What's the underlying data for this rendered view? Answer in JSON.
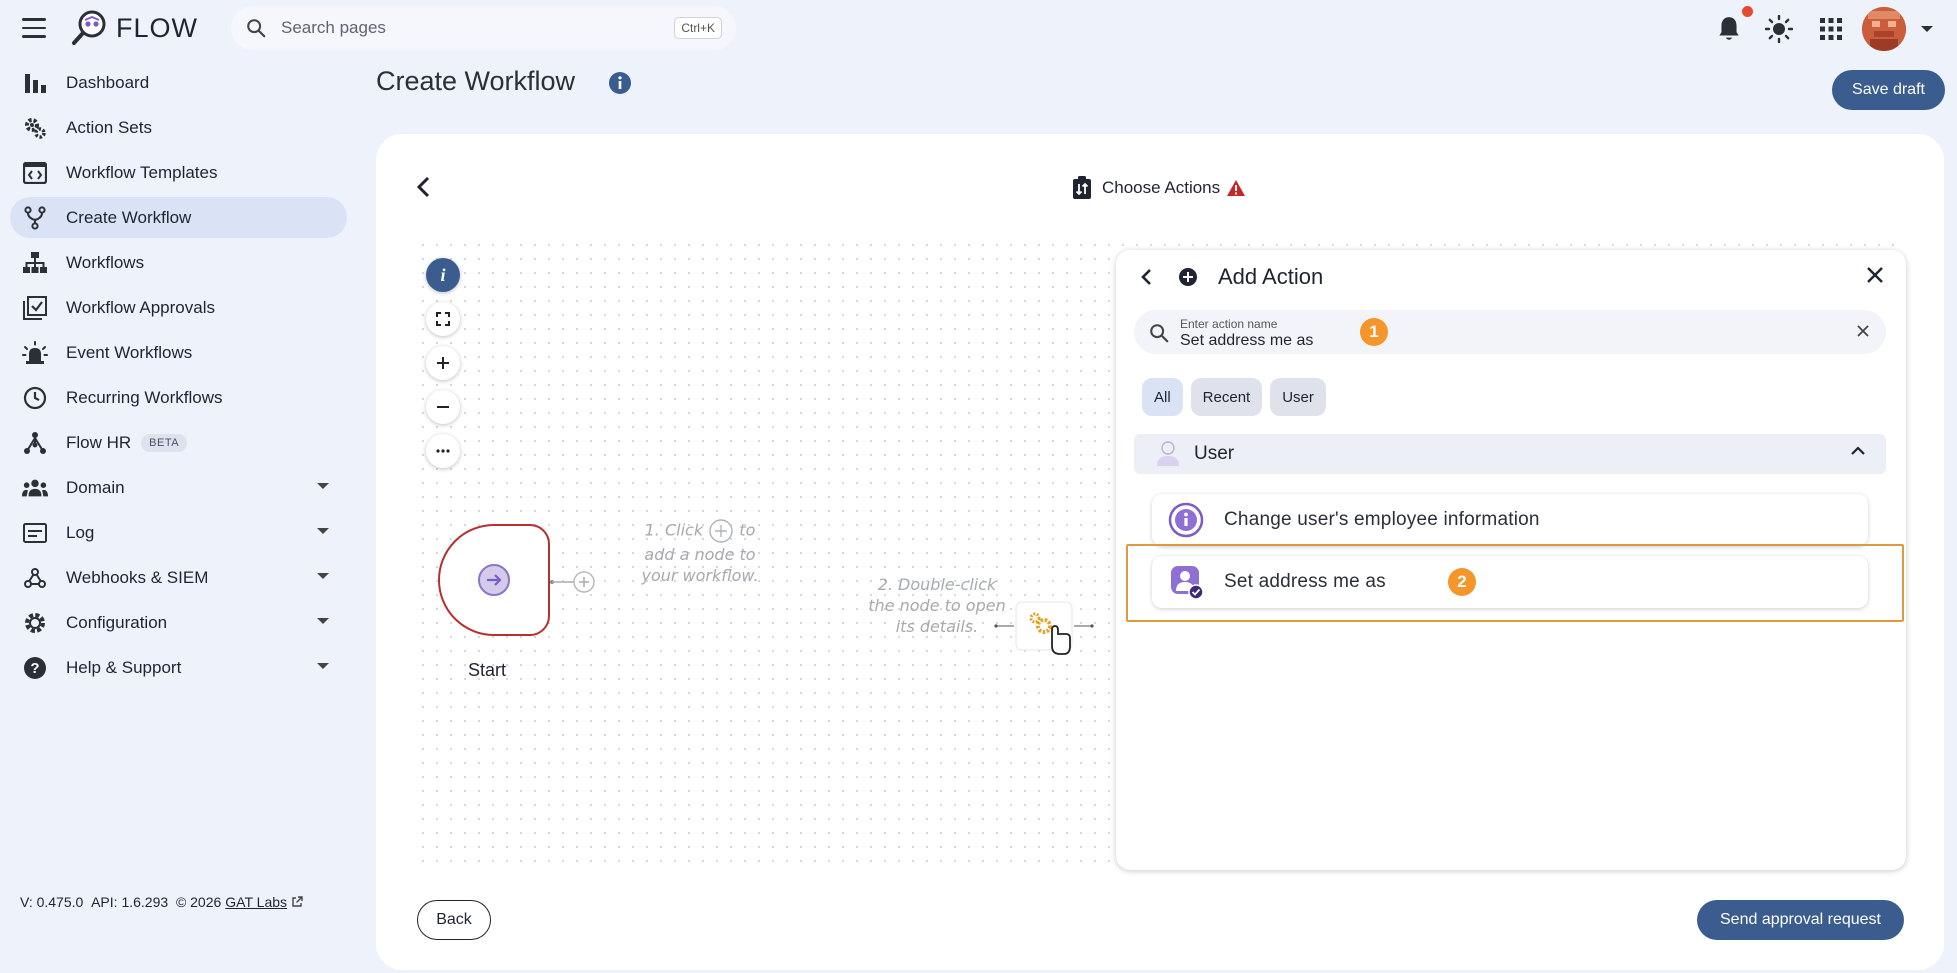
{
  "app": {
    "name": "FLOW"
  },
  "search": {
    "placeholder": "Search pages",
    "shortcut": "Ctrl+K"
  },
  "sidebar": {
    "items": [
      {
        "label": "Dashboard",
        "icon": "bar-chart-icon"
      },
      {
        "label": "Action Sets",
        "icon": "gears-icon"
      },
      {
        "label": "Workflow Templates",
        "icon": "code-window-icon"
      },
      {
        "label": "Create Workflow",
        "icon": "fork-icon",
        "active": true
      },
      {
        "label": "Workflows",
        "icon": "hierarchy-icon"
      },
      {
        "label": "Workflow Approvals",
        "icon": "checklist-icon"
      },
      {
        "label": "Event Workflows",
        "icon": "alarm-light-icon"
      },
      {
        "label": "Recurring Workflows",
        "icon": "clock-icon"
      },
      {
        "label": "Flow HR",
        "icon": "people-network-icon",
        "badge": "BETA"
      },
      {
        "label": "Domain",
        "icon": "group-icon",
        "expandable": true
      },
      {
        "label": "Log",
        "icon": "log-icon",
        "expandable": true
      },
      {
        "label": "Webhooks & SIEM",
        "icon": "webhook-icon",
        "expandable": true
      },
      {
        "label": "Configuration",
        "icon": "gear-icon",
        "expandable": true
      },
      {
        "label": "Help & Support",
        "icon": "help-icon",
        "expandable": true
      }
    ],
    "footer": {
      "version": "V: 0.475.0",
      "api": "API: 1.6.293",
      "copyright": "© 2026",
      "company_link": "GAT Labs"
    }
  },
  "header": {
    "title": "Create Workflow",
    "save_label": "Save draft"
  },
  "step": {
    "title": "Choose Actions"
  },
  "canvas": {
    "start_label": "Start",
    "hint1_pre": "1. Click",
    "hint1_post": "to",
    "hint1_line2": "add a node to",
    "hint1_line3": "your workflow.",
    "hint2_line1": "2. Double-click",
    "hint2_line2": "the node to open",
    "hint2_line3": "its details."
  },
  "panel": {
    "title": "Add Action",
    "search_label": "Enter action name",
    "search_value": "Set address me as",
    "badge1": "1",
    "badge2": "2",
    "chips": [
      "All",
      "Recent",
      "User"
    ],
    "group": "User",
    "actions": [
      "Change user's employee information",
      "Set address me as"
    ]
  },
  "footer": {
    "back_label": "Back",
    "send_label": "Send approval request"
  },
  "colors": {
    "primary": "#3a5c8e",
    "accent_orange": "#f4962a",
    "warning_red": "#c62828",
    "start_border": "#b5302e"
  }
}
